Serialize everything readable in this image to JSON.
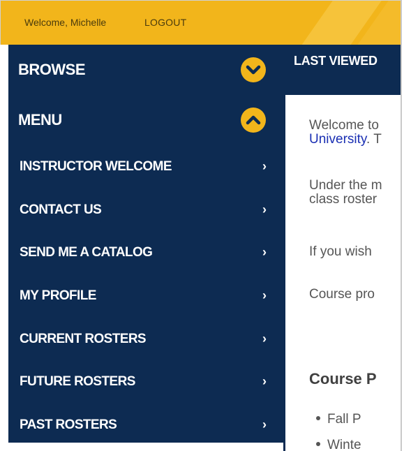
{
  "topbar": {
    "welcome": "Welcome, Michelle",
    "logout_label": "LOGOUT"
  },
  "sidebar": {
    "browse_label": "BROWSE",
    "menu_label": "MENU",
    "items": [
      {
        "label": "INSTRUCTOR WELCOME",
        "chevron": "›"
      },
      {
        "label": "CONTACT US",
        "chevron": "›"
      },
      {
        "label": "SEND ME A CATALOG",
        "chevron": "›"
      },
      {
        "label": "MY PROFILE",
        "chevron": "›"
      },
      {
        "label": "CURRENT ROSTERS",
        "chevron": "›"
      },
      {
        "label": "FUTURE ROSTERS",
        "chevron": "›"
      },
      {
        "label": "PAST ROSTERS",
        "chevron": "›"
      }
    ]
  },
  "content": {
    "last_viewed_label": "LAST VIEWED",
    "paragraphs": {
      "welcome_line1": "Welcome to",
      "welcome_line2_link": "University",
      "welcome_line2_rest": ". T",
      "under_line1": "Under the m",
      "under_line2": "class roster",
      "if_wish": "If you wish",
      "course_pro": "Course pro"
    },
    "section_heading": "Course P",
    "bullets": [
      "Fall P",
      "Winte"
    ]
  },
  "colors": {
    "topbar_gold": "#f2b51b",
    "navy": "#0d2b52",
    "link_blue": "#1a2fb3",
    "body_text": "#555555"
  },
  "icons": {
    "browse_toggle": "chevron-down-circle-icon",
    "menu_toggle": "chevron-up-circle-icon",
    "menu_item": "chevron-right-icon"
  }
}
